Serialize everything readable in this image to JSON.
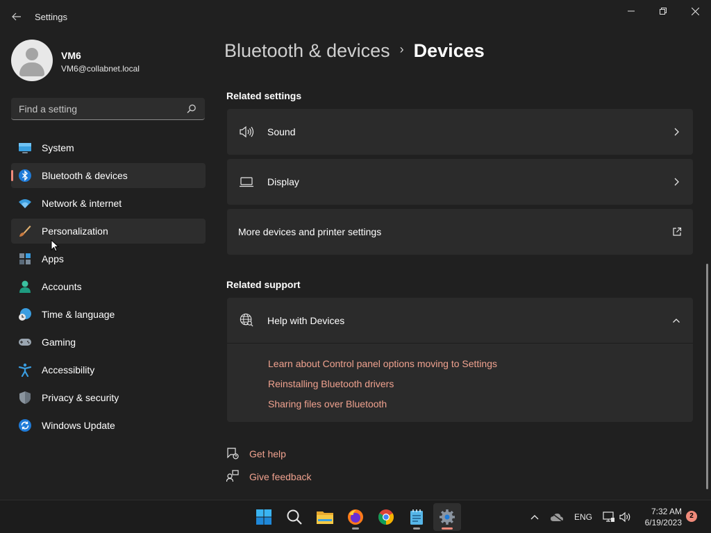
{
  "window": {
    "title": "Settings"
  },
  "profile": {
    "name": "VM6",
    "email": "VM6@collabnet.local"
  },
  "search": {
    "placeholder": "Find a setting"
  },
  "sidebar": {
    "items": [
      {
        "label": "System",
        "icon": "system-icon"
      },
      {
        "label": "Bluetooth & devices",
        "icon": "bluetooth-icon",
        "selected": true
      },
      {
        "label": "Network & internet",
        "icon": "wifi-icon"
      },
      {
        "label": "Personalization",
        "icon": "brush-icon",
        "hovered": true
      },
      {
        "label": "Apps",
        "icon": "apps-icon"
      },
      {
        "label": "Accounts",
        "icon": "person-icon"
      },
      {
        "label": "Time & language",
        "icon": "globe-clock-icon"
      },
      {
        "label": "Gaming",
        "icon": "gamepad-icon"
      },
      {
        "label": "Accessibility",
        "icon": "accessibility-icon"
      },
      {
        "label": "Privacy & security",
        "icon": "shield-icon"
      },
      {
        "label": "Windows Update",
        "icon": "update-icon"
      }
    ]
  },
  "breadcrumb": {
    "parent": "Bluetooth & devices",
    "separator": "›",
    "current": "Devices"
  },
  "related_settings": {
    "heading": "Related settings",
    "items": [
      {
        "label": "Sound",
        "icon": "speaker-icon",
        "action": "chevron-right-icon"
      },
      {
        "label": "Display",
        "icon": "laptop-icon",
        "action": "chevron-right-icon"
      },
      {
        "label": "More devices and printer settings",
        "action": "external-link-icon"
      }
    ]
  },
  "related_support": {
    "heading": "Related support",
    "help": {
      "title": "Help with Devices",
      "expanded": true,
      "links": [
        "Learn about Control panel options moving to Settings",
        "Reinstalling Bluetooth drivers",
        "Sharing files over Bluetooth"
      ]
    }
  },
  "footer_links": {
    "get_help": "Get help",
    "give_feedback": "Give feedback"
  },
  "taskbar": {
    "apps": [
      "start-icon",
      "search-icon",
      "file-explorer-icon",
      "firefox-icon",
      "chrome-icon",
      "notepad-icon",
      "settings-icon"
    ],
    "active_app": "settings-icon",
    "language": "ENG",
    "time": "7:32 AM",
    "date": "6/19/2023",
    "notification_count": "2"
  },
  "colors": {
    "accent": "#f08a7a",
    "link": "#f0a28f",
    "background": "#202020",
    "card": "#2b2b2b"
  }
}
